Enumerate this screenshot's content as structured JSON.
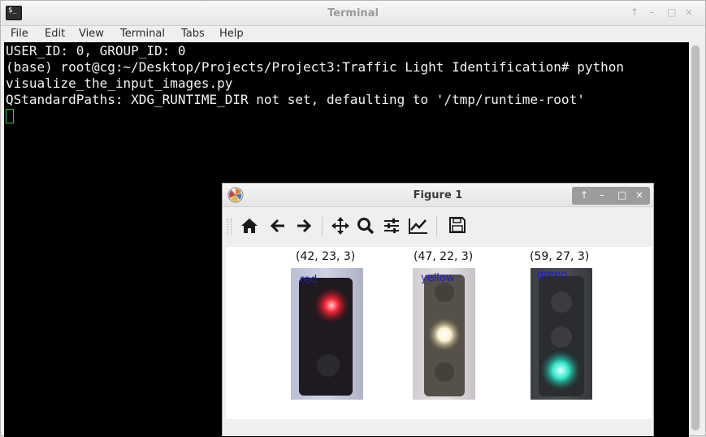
{
  "terminal": {
    "title": "Terminal",
    "menu": [
      "File",
      "Edit",
      "View",
      "Terminal",
      "Tabs",
      "Help"
    ],
    "window_controls": [
      "↑",
      "–",
      "□",
      "×"
    ],
    "lines": [
      "USER_ID: 0, GROUP_ID: 0",
      "(base) root@cg:~/Desktop/Projects/Project3:Traffic Light Identification# python",
      "visualize_the_input_images.py",
      "QStandardPaths: XDG_RUNTIME_DIR not set, defaulting to '/tmp/runtime-root'"
    ]
  },
  "figure": {
    "title": "Figure 1",
    "window_controls": [
      "↑",
      "–",
      "□",
      "×"
    ],
    "toolbar": {
      "home": "home-icon",
      "back": "back-arrow-icon",
      "forward": "forward-arrow-icon",
      "pan": "pan-icon",
      "zoom": "zoom-icon",
      "configure": "subplots-config-icon",
      "edit": "edit-axes-icon",
      "save": "save-icon"
    },
    "panels": [
      {
        "shape": "(42, 23, 3)",
        "label": "red",
        "light_color": "#ff2a3a"
      },
      {
        "shape": "(47, 22, 3)",
        "label": "yellow",
        "light_color": "#fff3d0"
      },
      {
        "shape": "(59, 27, 3)",
        "label": "green",
        "light_color": "#2fe8c8"
      }
    ]
  }
}
